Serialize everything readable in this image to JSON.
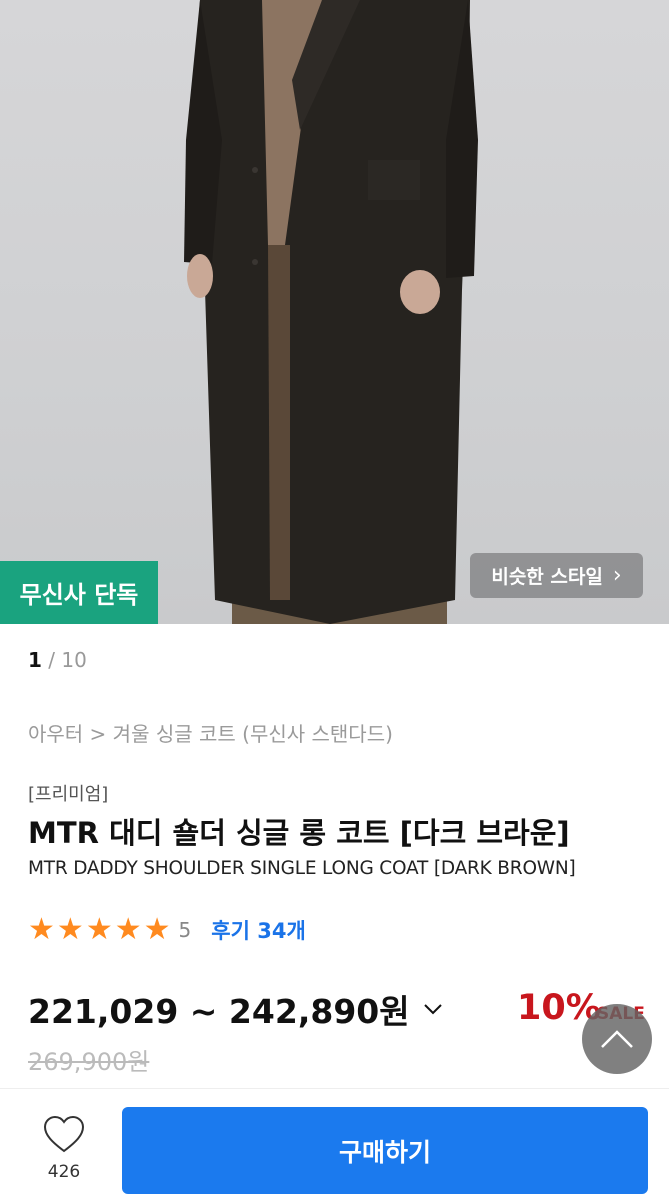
{
  "hero": {
    "exclusive_badge": "무신사 단독",
    "similar_style_label": "비슷한 스타일",
    "similar_style_icon": "chevron-right-icon"
  },
  "pager": {
    "current": "1",
    "separator": " / ",
    "total": "10"
  },
  "breadcrumb": "아우터 > 겨울 싱글 코트 (무신사 스탠다드)",
  "product": {
    "tag": "[프리미엄]",
    "title": "MTR 대디 숄더 싱글 롱 코트 [다크 브라운]",
    "subtitle": "MTR DADDY SHOULDER SINGLE LONG COAT [DARK BROWN]"
  },
  "rating": {
    "stars": 5,
    "score": "5",
    "reviews_label": "후기 34개"
  },
  "price": {
    "range": "221,029 ~ 242,890원",
    "original": "269,900원",
    "discount": "10%",
    "sale_label": "SALE"
  },
  "bottom": {
    "like_count": "426",
    "buy_label": "구매하기"
  },
  "colors": {
    "accent_blue": "#1b7aee",
    "exclusive_green": "#1aa37f",
    "discount_red": "#c8161d",
    "star_orange": "#ff8a1f"
  }
}
